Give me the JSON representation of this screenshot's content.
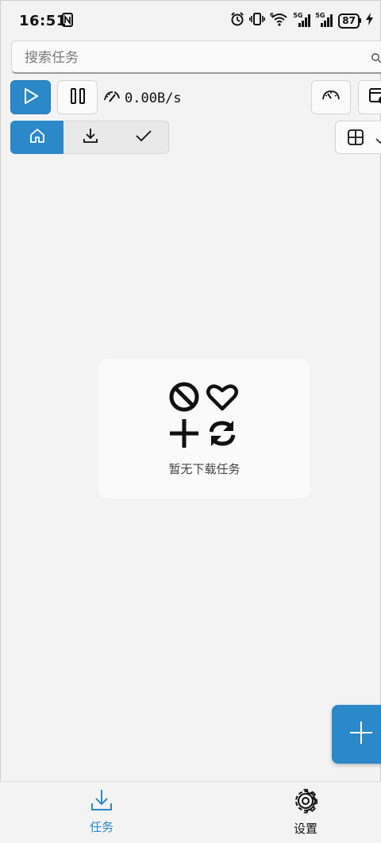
{
  "status_bar": {
    "time": "16:51",
    "battery": "87",
    "network_tags": [
      "5G",
      "5G"
    ]
  },
  "search": {
    "placeholder": "搜索任务",
    "value": ""
  },
  "toolbar": {
    "speed": "0.00B/s",
    "buttons": [
      "play-icon",
      "pause-icon",
      "speed-limit-icon",
      "window-icon"
    ]
  },
  "tabs": [
    {
      "icon": "home-icon",
      "active": true
    },
    {
      "icon": "download-icon",
      "active": false
    },
    {
      "icon": "check-icon",
      "active": false
    }
  ],
  "empty_state": {
    "message": "暂无下载任务"
  },
  "bottom_nav": {
    "items": [
      {
        "label": "任务",
        "icon": "download-icon",
        "active": true
      },
      {
        "label": "设置",
        "icon": "gear-icon",
        "active": false
      }
    ]
  },
  "colors": {
    "accent": "#2b88c9",
    "background": "#f3f3f3",
    "card": "#fafafa"
  }
}
